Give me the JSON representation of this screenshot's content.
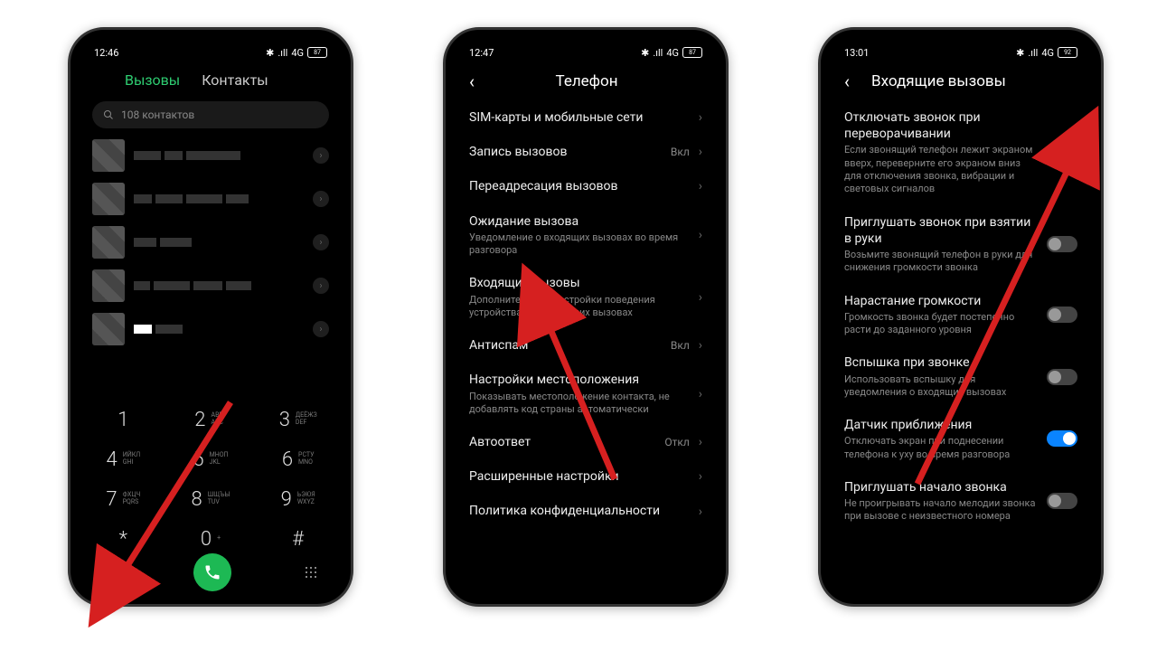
{
  "phone1": {
    "status": {
      "time": "12:46",
      "net": "4G",
      "signal": ".ıll",
      "bt": "✱",
      "batt": "87"
    },
    "tabs": {
      "calls": "Вызовы",
      "contacts": "Контакты"
    },
    "search": {
      "placeholder": "108 контактов"
    },
    "dialpad": [
      {
        "num": "1",
        "letters": ""
      },
      {
        "num": "2",
        "letters": "ABBГ\nABC"
      },
      {
        "num": "3",
        "letters": "ДЕЁЖЗ\nDEF"
      },
      {
        "num": "4",
        "letters": "ИЙКЛ\nGHI"
      },
      {
        "num": "5",
        "letters": "МНОП\nJKL"
      },
      {
        "num": "6",
        "letters": "РСТУ\nMNO"
      },
      {
        "num": "7",
        "letters": "ФХЦЧ\nPQRS"
      },
      {
        "num": "8",
        "letters": "ШЩЪЫ\nTUV"
      },
      {
        "num": "9",
        "letters": "ЬЭЮЯ\nWXYZ"
      },
      {
        "num": "*",
        "letters": ""
      },
      {
        "num": "0",
        "letters": "+"
      },
      {
        "num": "#",
        "letters": ""
      }
    ]
  },
  "phone2": {
    "status": {
      "time": "12:47",
      "net": "4G",
      "signal": ".ıll",
      "bt": "✱",
      "batt": "87"
    },
    "header": "Телефон",
    "items": [
      {
        "title": "SIM-карты и мобильные сети"
      },
      {
        "title": "Запись вызовов",
        "val": "Вкл"
      },
      {
        "title": "Переадресация вызовов"
      },
      {
        "title": "Ожидание вызова",
        "sub": "Уведомление о входящих вызовах во время разговора"
      },
      {
        "title": "Входящие вызовы",
        "sub": "Дополнительные настройки поведения устройства при входящих вызовах"
      },
      {
        "title": "Антиспам",
        "val": "Вкл"
      },
      {
        "title": "Настройки местоположения",
        "sub": "Показывать местоположение контакта, не добавлять код страны автоматически"
      },
      {
        "title": "Автоответ",
        "val": "Откл"
      },
      {
        "title": "Расширенные настройки"
      },
      {
        "title": "Политика конфиденциальности"
      }
    ]
  },
  "phone3": {
    "status": {
      "time": "13:01",
      "net": "4G",
      "signal": ".ıll",
      "bt": "✱",
      "batt": "92"
    },
    "header": "Входящие вызовы",
    "items": [
      {
        "title": "Отключать звонок при переворачивании",
        "sub": "Если звонящий телефон лежит экраном вверх, переверните его экраном вниз для отключения звонка, вибрации и световых сигналов",
        "on": true
      },
      {
        "title": "Приглушать звонок при взятии в руки",
        "sub": "Возьмите звонящий телефон в руки для снижения громкости звонка",
        "on": false
      },
      {
        "title": "Нарастание громкости",
        "sub": "Громкость звонка будет постепенно расти до заданного уровня",
        "on": false
      },
      {
        "title": "Вспышка при звонке",
        "sub": "Использовать вспышку для уведомления о входящих вызовах",
        "on": false
      },
      {
        "title": "Датчик приближения",
        "sub": "Отключать экран при поднесении телефона к уху во время разговора",
        "on": true
      },
      {
        "title": "Приглушать начало звонка",
        "sub": "Не проигрывать начало мелодии звонка при вызове с неизвестного номера",
        "on": false
      }
    ]
  }
}
